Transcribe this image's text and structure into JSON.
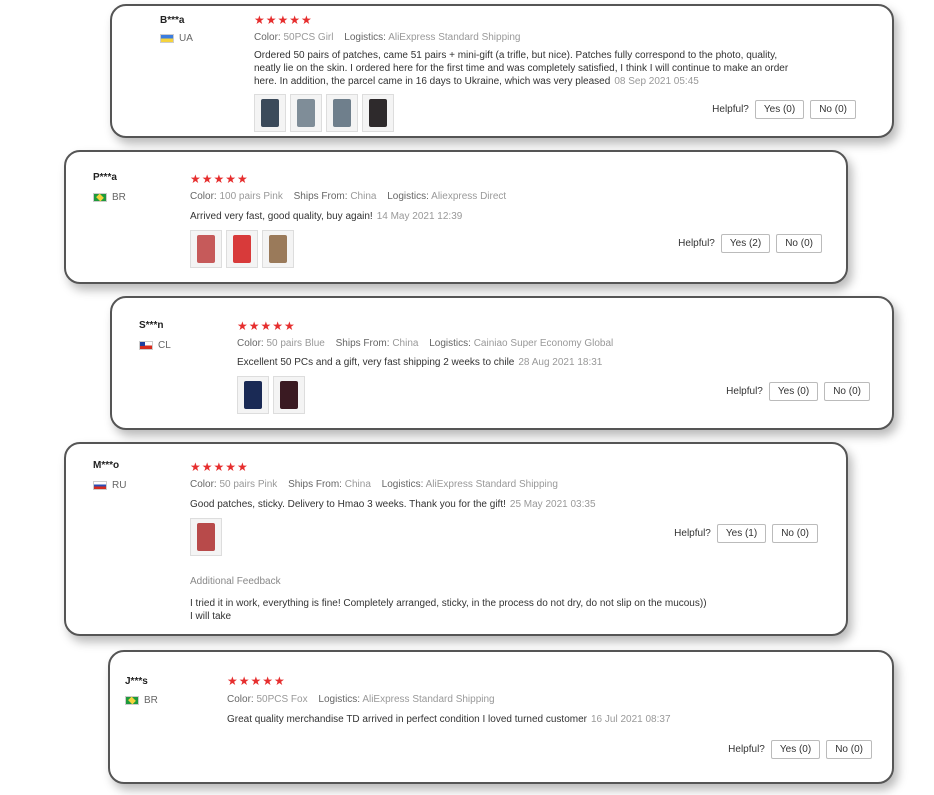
{
  "helpful_label": "Helpful?",
  "reviews": [
    {
      "user": "B***a",
      "country": "UA",
      "stars": "★★★★★",
      "meta": [
        {
          "label": "Color:",
          "value": "50PCS Girl"
        },
        {
          "label": "Logistics:",
          "value": "AliExpress Standard Shipping"
        }
      ],
      "text": "Ordered 50 pairs of patches, came 51 pairs + mini-gift (a trifle, but nice). Patches fully correspond to the photo, quality, neatly lie on the skin. I ordered here for the first time and was completely satisfied, I think I will continue to make an order here. In addition, the parcel came in 16 days to Ukraine, which was very pleased",
      "date": "08 Sep 2021 05:45",
      "yes": "Yes (0)",
      "no": "No (0)"
    },
    {
      "user": "P***a",
      "country": "BR",
      "stars": "★★★★★",
      "meta": [
        {
          "label": "Color:",
          "value": "100 pairs Pink"
        },
        {
          "label": "Ships From:",
          "value": "China"
        },
        {
          "label": "Logistics:",
          "value": "Aliexpress Direct"
        }
      ],
      "text": "Arrived very fast, good quality, buy again!",
      "date": "14 May 2021 12:39",
      "yes": "Yes (2)",
      "no": "No (0)"
    },
    {
      "user": "S***n",
      "country": "CL",
      "stars": "★★★★★",
      "meta": [
        {
          "label": "Color:",
          "value": "50 pairs Blue"
        },
        {
          "label": "Ships From:",
          "value": "China"
        },
        {
          "label": "Logistics:",
          "value": "Cainiao Super Economy Global"
        }
      ],
      "text": "Excellent 50 PCs and a gift, very fast shipping 2 weeks to chile",
      "date": "28 Aug 2021 18:31",
      "yes": "Yes (0)",
      "no": "No (0)"
    },
    {
      "user": "M***o",
      "country": "RU",
      "stars": "★★★★★",
      "meta": [
        {
          "label": "Color:",
          "value": "50 pairs Pink"
        },
        {
          "label": "Ships From:",
          "value": "China"
        },
        {
          "label": "Logistics:",
          "value": "AliExpress Standard Shipping"
        }
      ],
      "text": "Good patches, sticky. Delivery to Hmao 3 weeks. Thank you for the gift!",
      "date": "25 May 2021 03:35",
      "yes": "Yes (1)",
      "no": "No (0)",
      "additional_title": "Additional Feedback",
      "additional_text": "I tried it in work, everything is fine! Completely arranged, sticky, in the process do not dry, do not slip on the mucous)) I will take"
    },
    {
      "user": "J***s",
      "country": "BR",
      "stars": "★★★★★",
      "meta": [
        {
          "label": "Color:",
          "value": "50PCS Fox"
        },
        {
          "label": "Logistics:",
          "value": "AliExpress Standard Shipping"
        }
      ],
      "text": "Great quality merchandise TD arrived in perfect condition I loved turned customer",
      "date": "16 Jul 2021 08:37",
      "yes": "Yes (0)",
      "no": "No (0)"
    }
  ]
}
